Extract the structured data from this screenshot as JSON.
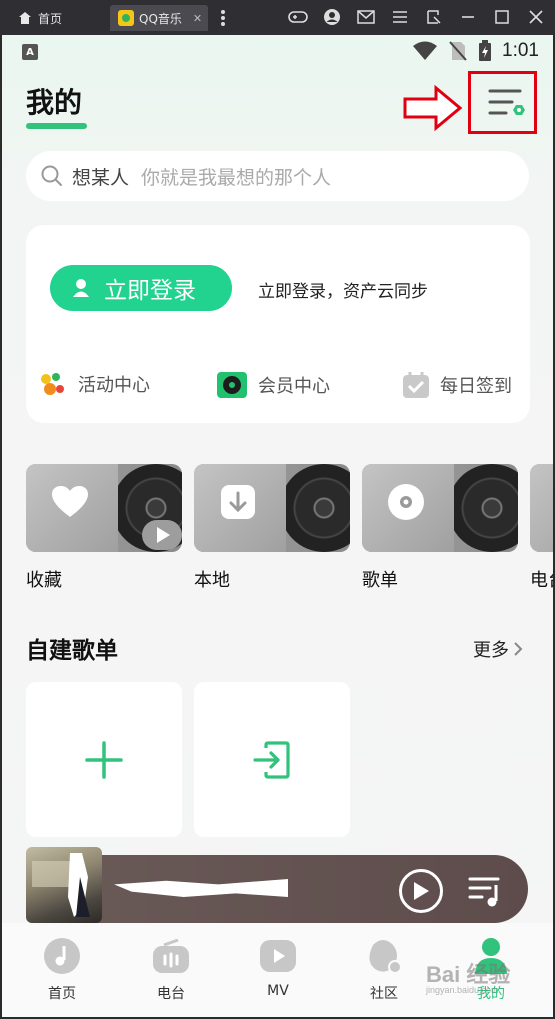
{
  "window": {
    "home_tab_label": "首页",
    "active_tab_label": "QQ音乐",
    "close_glyph": "✕",
    "icons": [
      "gamepad-icon",
      "user-icon",
      "mail-icon",
      "menu-icon",
      "resize-icon",
      "minimize-icon",
      "maximize-icon",
      "close-icon"
    ]
  },
  "status_bar": {
    "badge": "A",
    "time": "1:01"
  },
  "header": {
    "title": "我的"
  },
  "search": {
    "query": "想某人",
    "placeholder": "你就是我最想的那个人"
  },
  "login_card": {
    "button_label": "立即登录",
    "hint": "立即登录，资产云同步",
    "shortcuts": [
      {
        "label": "活动中心",
        "icon": "activity-icon"
      },
      {
        "label": "会员中心",
        "icon": "vip-icon"
      },
      {
        "label": "每日签到",
        "icon": "checkin-icon"
      }
    ]
  },
  "quick_access": [
    {
      "label": "收藏",
      "icon": "heart-icon"
    },
    {
      "label": "本地",
      "icon": "download-icon"
    },
    {
      "label": "歌单",
      "icon": "disc-icon"
    },
    {
      "label": "电台",
      "icon": "radio-icon"
    }
  ],
  "my_playlists": {
    "title": "自建歌单",
    "more_label": "更多"
  },
  "bottom_nav": [
    {
      "label": "首页",
      "icon": "music-note-icon"
    },
    {
      "label": "电台",
      "icon": "radio-icon"
    },
    {
      "label": "MV",
      "icon": "video-icon"
    },
    {
      "label": "社区",
      "icon": "community-icon"
    },
    {
      "label": "我的",
      "icon": "profile-icon",
      "active": true
    }
  ],
  "watermark": {
    "text": "Bai 经验",
    "sub": "jingyan.baidu.com"
  },
  "colors": {
    "accent": "#31c27c",
    "login_button": "#22d38f",
    "annotation": "#e0000f"
  }
}
